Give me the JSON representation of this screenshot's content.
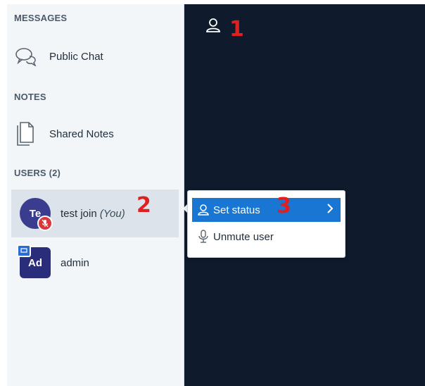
{
  "sidebar": {
    "messages_title": "MESSAGES",
    "public_chat": {
      "label": "Public Chat",
      "icon": "chat-bubbles-icon"
    },
    "notes_title": "NOTES",
    "shared_notes": {
      "label": "Shared Notes",
      "icon": "notes-icon"
    },
    "users_title": "USERS (2)",
    "users": [
      {
        "initials": "Te",
        "name": "test join",
        "suffix": "(You)",
        "selected": true,
        "badge": "muted-mic-icon"
      },
      {
        "initials": "Ad",
        "name": "admin",
        "selected": false,
        "badge": "presenter-icon"
      }
    ]
  },
  "annotations": {
    "one": "1",
    "two": "2",
    "three": "3"
  },
  "context_menu": {
    "items": [
      {
        "label": "Set status",
        "icon": "user-icon",
        "active": true
      },
      {
        "label": "Unmute user",
        "icon": "microphone-icon",
        "active": false
      }
    ]
  },
  "colors": {
    "sidebar_bg": "#f3f6f9",
    "main_bg": "#0f1a2c",
    "accent": "#1976d2",
    "avatar": "#3a3d8f",
    "annotation_red": "#e02020"
  }
}
